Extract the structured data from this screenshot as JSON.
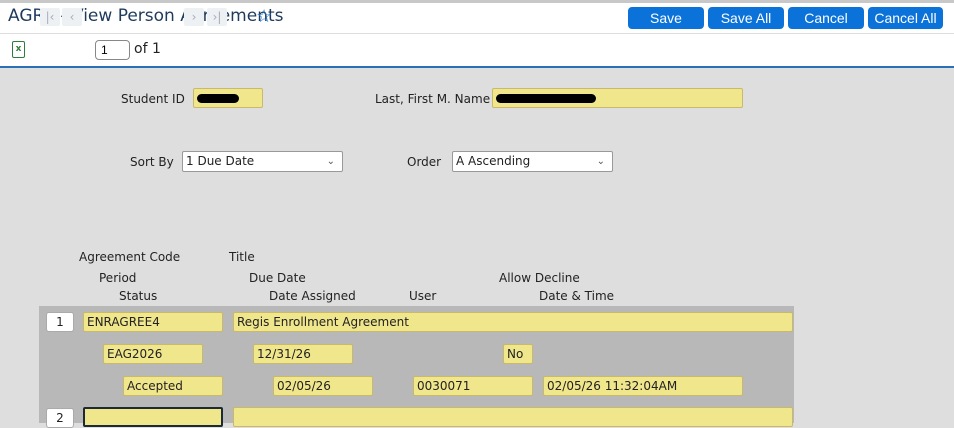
{
  "header": {
    "title": "AGRV - View Person Agreements",
    "favorite_icon": "star-outline-icon",
    "buttons": {
      "save": "Save",
      "save_all": "Save All",
      "cancel": "Cancel",
      "cancel_all": "Cancel All"
    },
    "button_color": "#0b72d9"
  },
  "toolbar": {
    "export_icon": "excel-icon",
    "page": "1",
    "of_label": "of 1"
  },
  "form": {
    "student_id_label": "Student ID",
    "name_label": "Last, First M. Name",
    "sort_by_label": "Sort By",
    "sort_by_value": "1 Due Date",
    "order_label": "Order",
    "order_value": "A Ascending"
  },
  "columns": {
    "agreement_code": "Agreement Code",
    "title": "Title",
    "period": "Period",
    "due_date": "Due Date",
    "allow_decline": "Allow Decline",
    "status": "Status",
    "date_assigned": "Date Assigned",
    "user": "User",
    "date_time": "Date & Time"
  },
  "rows": [
    {
      "num": "1",
      "agreement_code": "ENRAGREE4",
      "title": "Regis Enrollment Agreement",
      "period": "EAG2026",
      "due_date": "12/31/26",
      "allow_decline": "No",
      "status": "Accepted",
      "date_assigned": "02/05/26",
      "user": "0030071",
      "date_time": "02/05/26 11:32:04AM"
    },
    {
      "num": "2",
      "agreement_code": "",
      "title": ""
    }
  ]
}
